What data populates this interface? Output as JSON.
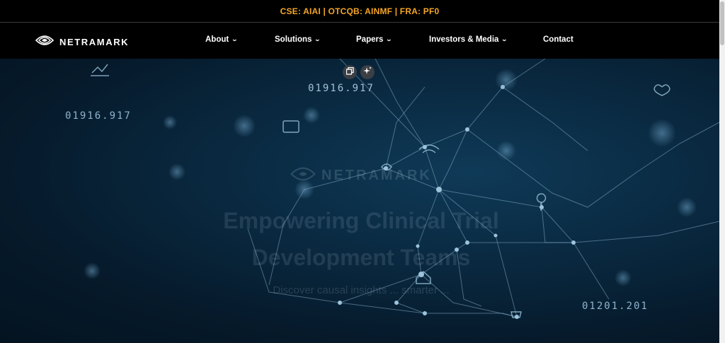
{
  "ticker": {
    "text": "CSE: AIAI | OTCQB: AINMF | FRA: PF0"
  },
  "header": {
    "logo_text": "NETRAMARK",
    "nav": [
      {
        "label": "About",
        "dropdown": true
      },
      {
        "label": "Solutions",
        "dropdown": true
      },
      {
        "label": "Papers",
        "dropdown": true
      },
      {
        "label": "Investors & Media",
        "dropdown": true
      },
      {
        "label": "Contact",
        "dropdown": false
      }
    ]
  },
  "hero": {
    "digit_labels": [
      "01916.917",
      "01916.917",
      "01201.201"
    ],
    "logo_text": "NETRAMARK",
    "title": "Empowering Clinical Trial Development Teams",
    "subtitle": "Discover causal insights ... smarter ..."
  },
  "toolbar": {
    "icons": [
      "copy-icon",
      "sparkle-icon"
    ]
  },
  "colors": {
    "ticker": "#f5a623",
    "nav_bg": "#000000",
    "hero_bg": "#0a2a42",
    "network_line": "#7fa8c4"
  }
}
